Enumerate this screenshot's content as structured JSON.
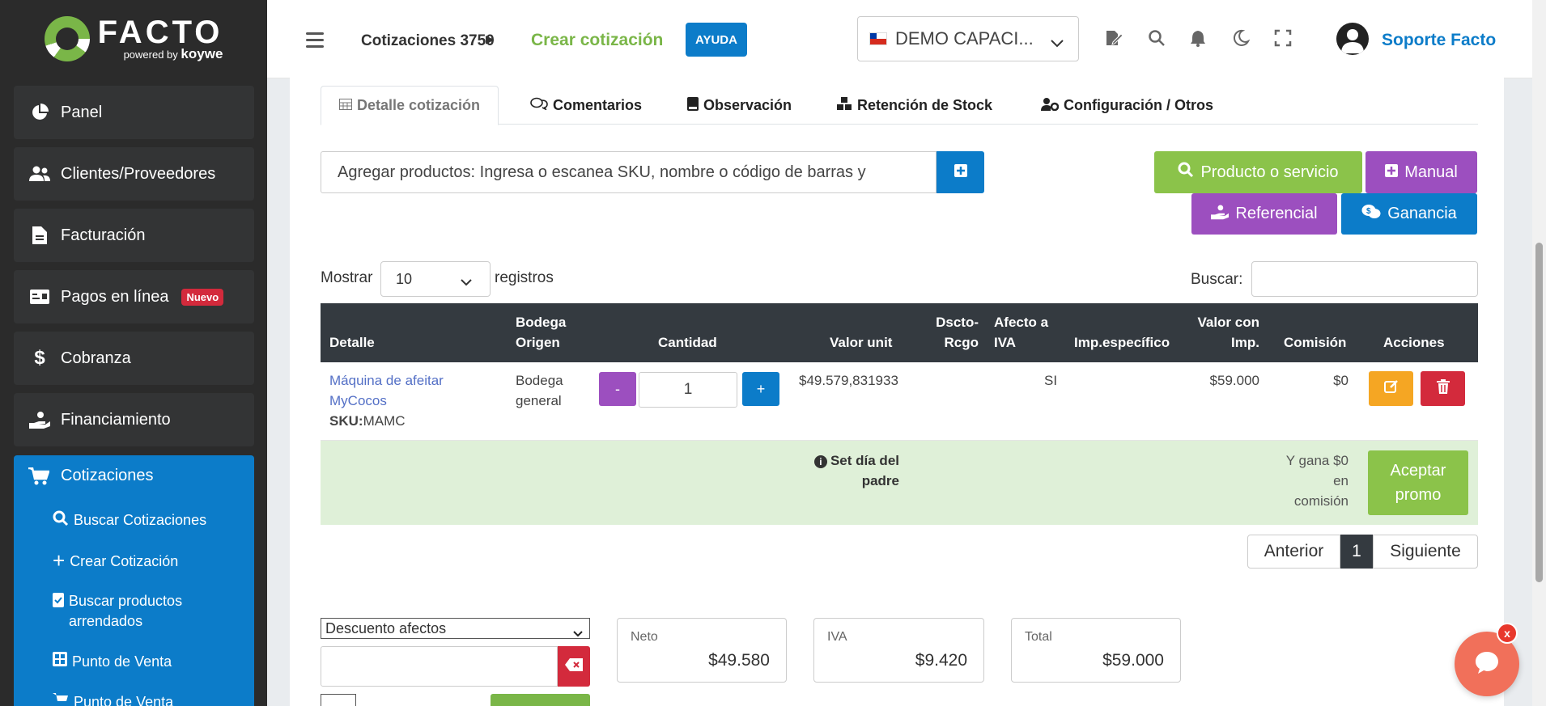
{
  "brand": {
    "name": "FACTO",
    "powered_by": "powered by",
    "koywe": "koywe"
  },
  "sidebar": {
    "items": [
      {
        "label": "Panel",
        "icon": "pie-chart-icon"
      },
      {
        "label": "Clientes/Proveedores",
        "icon": "users-icon"
      },
      {
        "label": "Facturación",
        "icon": "document-icon"
      },
      {
        "label": "Pagos en línea",
        "icon": "card-icon",
        "badge": "Nuevo"
      },
      {
        "label": "Cobranza",
        "icon": "dollar-icon"
      },
      {
        "label": "Financiamiento",
        "icon": "hand-money-icon"
      }
    ],
    "active": {
      "label": "Cotizaciones",
      "icon": "cart-icon",
      "subitems": [
        {
          "label": "Buscar Cotizaciones",
          "icon": "search-icon"
        },
        {
          "label": "Crear Cotización",
          "icon": "plus-icon"
        },
        {
          "label": "Buscar productos arrendados",
          "icon": "clipboard-check-icon"
        },
        {
          "label": "Punto de Venta",
          "icon": "grid-icon"
        },
        {
          "label": "Punto de Venta",
          "icon": "cart-plus-icon"
        }
      ]
    }
  },
  "header": {
    "breadcrumb_parent": "Cotizaciones 3750",
    "breadcrumb_current": "Crear cotización",
    "help": "AYUDA",
    "company": "DEMO CAPACI...",
    "user": "Soporte Facto"
  },
  "tabs": [
    {
      "label": "Detalle cotización",
      "icon": "table-icon"
    },
    {
      "label": "Comentarios",
      "icon": "comments-icon"
    },
    {
      "label": "Observación",
      "icon": "book-icon"
    },
    {
      "label": "Retención de Stock",
      "icon": "cubes-icon"
    },
    {
      "label": "Configuración / Otros",
      "icon": "user-cog-icon"
    }
  ],
  "add_products": {
    "placeholder": "Agregar productos: Ingresa o escanea SKU, nombre o código de barras y",
    "buttons": {
      "producto": "Producto o servicio",
      "manual": "Manual",
      "referencial": "Referencial",
      "ganancia": "Ganancia"
    }
  },
  "table_controls": {
    "show": "Mostrar",
    "page_size": "10",
    "records": "registros",
    "search": "Buscar:"
  },
  "table": {
    "headers": {
      "detalle": "Detalle",
      "bodega": [
        "Bodega",
        "Origen"
      ],
      "cantidad": "Cantidad",
      "valor_unit": "Valor unit",
      "dscto": [
        "Dscto-",
        "Rcgo"
      ],
      "afecto": [
        "Afecto a",
        "IVA"
      ],
      "imp": "Imp.específico",
      "valor_con_imp": [
        "Valor con",
        "Imp."
      ],
      "comision": "Comisión",
      "acciones": "Acciones"
    },
    "row": {
      "name_line1": "Máquina de afeitar",
      "name_line2": "MyCocos",
      "sku_label": "SKU:",
      "sku": "MAMC",
      "bodega_line1": "Bodega",
      "bodega_line2": "general",
      "minus": "-",
      "qty": "1",
      "plus": "+",
      "valor_unit": "$49.579,831933",
      "afecto": "SI",
      "valor_con_imp": "$59.000",
      "comision": "$0"
    },
    "promo": {
      "title_line1": "Set día del",
      "title_line2": "padre",
      "gain_line1": "Y gana $0",
      "gain_line2": "en",
      "gain_line3": "comisión",
      "accept_line1": "Aceptar",
      "accept_line2": "promo"
    }
  },
  "pagination": {
    "prev": "Anterior",
    "current": "1",
    "next": "Siguiente"
  },
  "discount": {
    "select": "Descuento afectos"
  },
  "totals": {
    "neto_label": "Neto",
    "neto": "$49.580",
    "iva_label": "IVA",
    "iva": "$9.420",
    "total_label": "Total",
    "total": "$59.000"
  },
  "chat": {
    "close": "x"
  }
}
